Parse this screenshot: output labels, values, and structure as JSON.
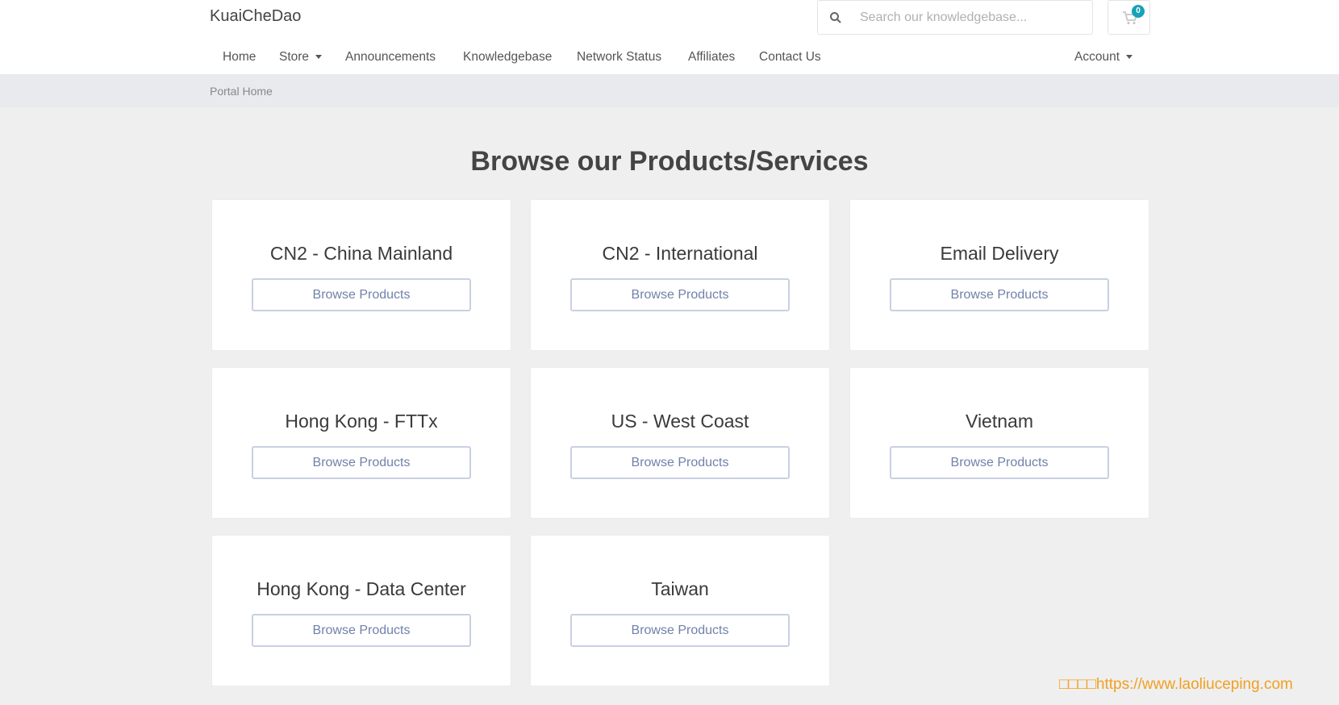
{
  "header": {
    "brand": "KuaiCheDao",
    "search": {
      "placeholder": "Search our knowledgebase..."
    },
    "cart": {
      "count": "0"
    }
  },
  "nav": {
    "items": [
      {
        "label": "Home"
      },
      {
        "label": "Store"
      },
      {
        "label": "Announcements"
      },
      {
        "label": "Knowledgebase"
      },
      {
        "label": "Network Status"
      },
      {
        "label": "Affiliates"
      },
      {
        "label": "Contact Us"
      }
    ],
    "account": "Account"
  },
  "breadcrumb": "Portal Home",
  "main": {
    "title": "Browse our Products/Services",
    "cards": [
      {
        "title": "CN2 - China Mainland",
        "button": "Browse Products"
      },
      {
        "title": "CN2 - International",
        "button": "Browse Products"
      },
      {
        "title": "Email Delivery",
        "button": "Browse Products"
      },
      {
        "title": "Hong Kong - FTTx",
        "button": "Browse Products"
      },
      {
        "title": "US - West Coast",
        "button": "Browse Products"
      },
      {
        "title": "Vietnam",
        "button": "Browse Products"
      },
      {
        "title": "Hong Kong - Data Center",
        "button": "Browse Products"
      },
      {
        "title": "Taiwan",
        "button": "Browse Products"
      }
    ]
  },
  "watermark": "□□□□https://www.laoliuceping.com",
  "colors": {
    "badge": "#17a2b8",
    "button_text": "#7081aa",
    "watermark": "#f0a020"
  }
}
